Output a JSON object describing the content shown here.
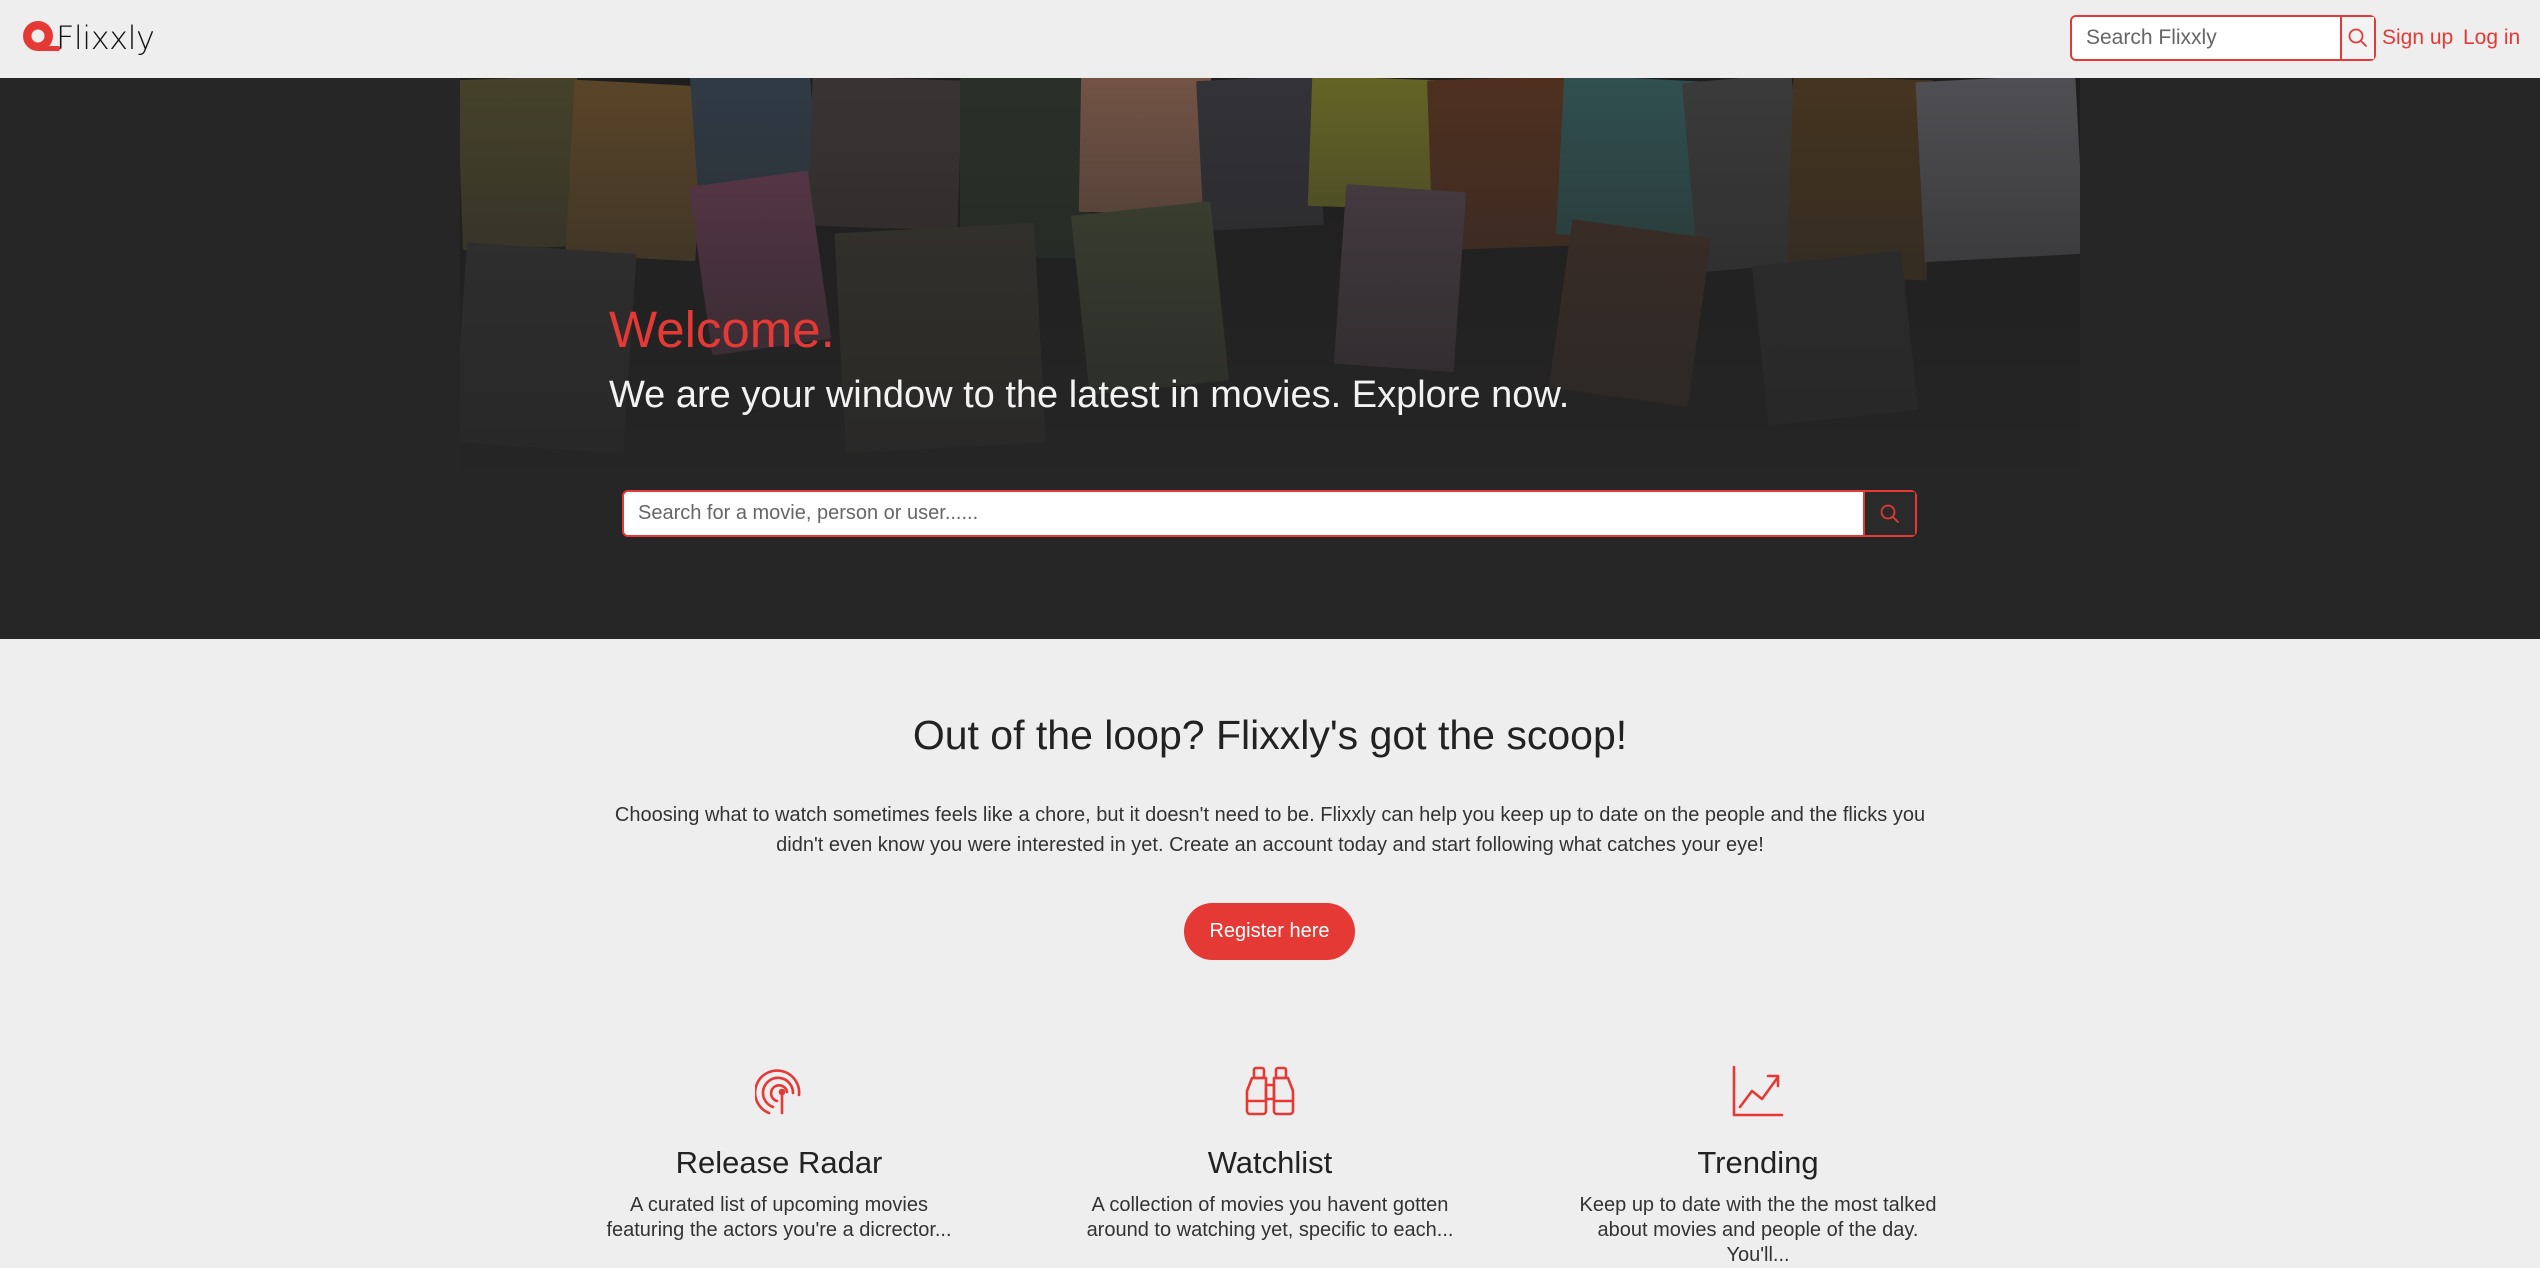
{
  "brand": {
    "name": "Flixxly",
    "color": "#e53935"
  },
  "navbar": {
    "search_placeholder": "Search Flixxly",
    "signup_label": "Sign up",
    "login_label": "Log in"
  },
  "hero": {
    "welcome": "Welcome.",
    "tagline": "We are your window to the latest in movies. Explore now.",
    "search_placeholder": "Search for a movie, person or user......"
  },
  "intro": {
    "heading": "Out of the loop? Flixxly's got the scoop!",
    "text": "Choosing what to watch sometimes feels like a chore, but it doesn't need to be. Flixxly can help you keep up to date on the people and the flicks you didn't even know you were interested in yet. Create an account today and start following what catches your eye!",
    "register_label": "Register here"
  },
  "features": [
    {
      "icon": "radar-icon",
      "title": "Release Radar",
      "desc": "A curated list of upcoming movies featuring the actors you're a dicrector..."
    },
    {
      "icon": "binoculars-icon",
      "title": "Watchlist",
      "desc": "A collection of movies you havent gotten around to watching yet, specific to each..."
    },
    {
      "icon": "trending-icon",
      "title": "Trending",
      "desc": "Keep up to date with the the most talked about movies and people of the day. You'll..."
    }
  ]
}
